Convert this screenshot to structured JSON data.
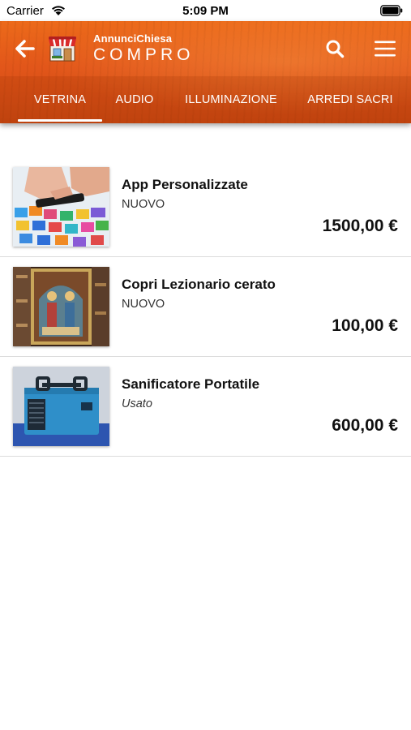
{
  "status_bar": {
    "carrier": "Carrier",
    "time": "5:09 PM",
    "wifi_icon": "wifi-icon",
    "battery_icon": "battery-icon"
  },
  "header": {
    "brand_small": "AnnunciChiesa",
    "brand_big": "COMPRO",
    "back_icon": "arrow-left-icon",
    "logo_icon": "shop-icon",
    "search_icon": "search-icon",
    "menu_icon": "hamburger-menu-icon",
    "accent_color": "#e3581a"
  },
  "tabs": [
    {
      "label": "VETRINA",
      "selected": true
    },
    {
      "label": "AUDIO",
      "selected": false
    },
    {
      "label": "ILLUMINAZIONE",
      "selected": false
    },
    {
      "label": "ARREDI SACRI",
      "selected": false
    }
  ],
  "items": [
    {
      "title": "App Personalizzate",
      "condition": "NUOVO",
      "price": "1500,00 €",
      "thumb_icon": "smartphone-apps-image"
    },
    {
      "title": "Copri Lezionario cerato",
      "condition": "NUOVO",
      "price": "100,00 €",
      "thumb_icon": "lectionary-cover-image"
    },
    {
      "title": "Sanificatore Portatile",
      "condition": "Usato",
      "price": "600,00 €",
      "thumb_icon": "sanitizer-device-image"
    }
  ]
}
